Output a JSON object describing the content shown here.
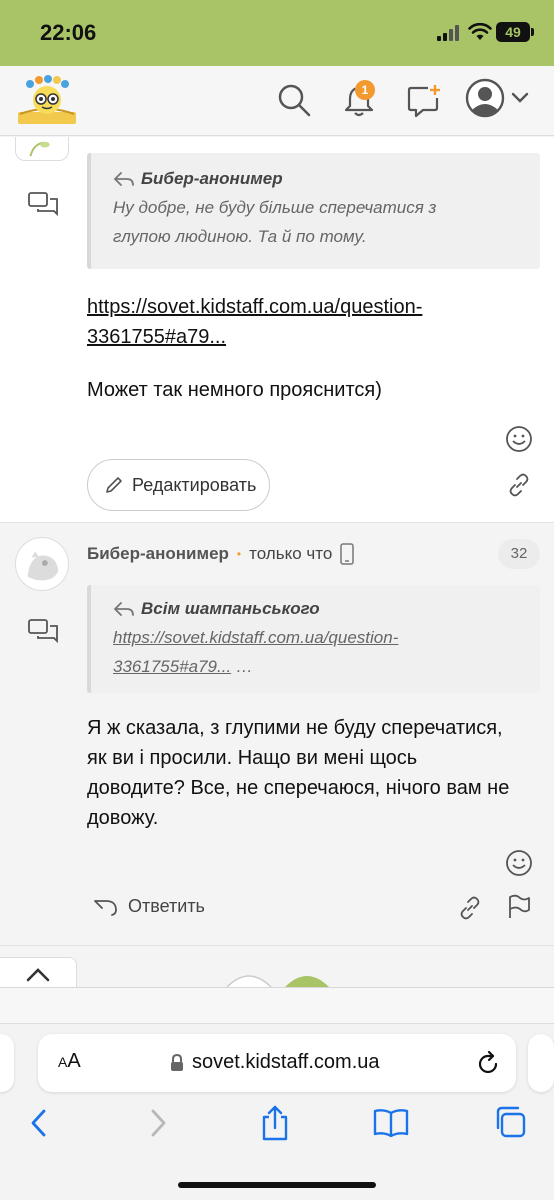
{
  "status": {
    "time": "22:06",
    "battery": "49"
  },
  "header": {
    "notification_count": "1"
  },
  "post1": {
    "quote_author": "Бибер-анонимер",
    "quote_lines": [
      "Ну добре, не буду більше сперечатися з",
      "глупою людиною. Та й по тому."
    ],
    "link_lines": [
      "https://sovet.kidstaff.com.ua/question-",
      "3361755#a79..."
    ],
    "text": "Может так немного прояснится)",
    "edit_label": "Редактировать"
  },
  "post2": {
    "author": "Бибер-анонимер",
    "online_dot": "•",
    "time": "только что",
    "number": "32",
    "quote_author": "Всім шампаньського",
    "quote_link_lines": [
      "https://sovet.kidstaff.com.ua/question-",
      "3361755#a79..."
    ],
    "quote_ellipsis": "…",
    "text_lines": [
      "Я ж сказала, з глупими не буду сперечатися,",
      "як ви і просили. Нащо ви мені щось",
      "доводите? Все, не сперечаюся, нічого вам не",
      "довожу."
    ],
    "reply_label": "Ответить"
  },
  "browser": {
    "url": "sovet.kidstaff.com.ua",
    "text_size_label_small": "A",
    "text_size_label_large": "A"
  }
}
